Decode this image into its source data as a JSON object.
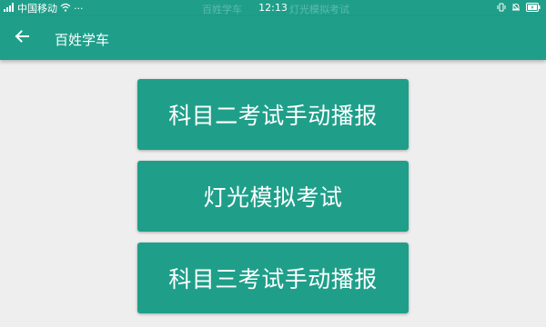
{
  "status_bar": {
    "carrier": "中国移动",
    "more": "···",
    "time": "12:13",
    "ghost_left": "百姓学车",
    "ghost_right": "灯光模拟考试"
  },
  "app_bar": {
    "title": "百姓学车",
    "back_icon": "arrow-left-icon"
  },
  "buttons": [
    {
      "label": "科目二考试手动播报"
    },
    {
      "label": "灯光模拟考试"
    },
    {
      "label": "科目三考试手动播报"
    }
  ],
  "colors": {
    "primary": "#1f9f8a",
    "background": "#eeeeee",
    "text_on_primary": "#ffffff"
  }
}
